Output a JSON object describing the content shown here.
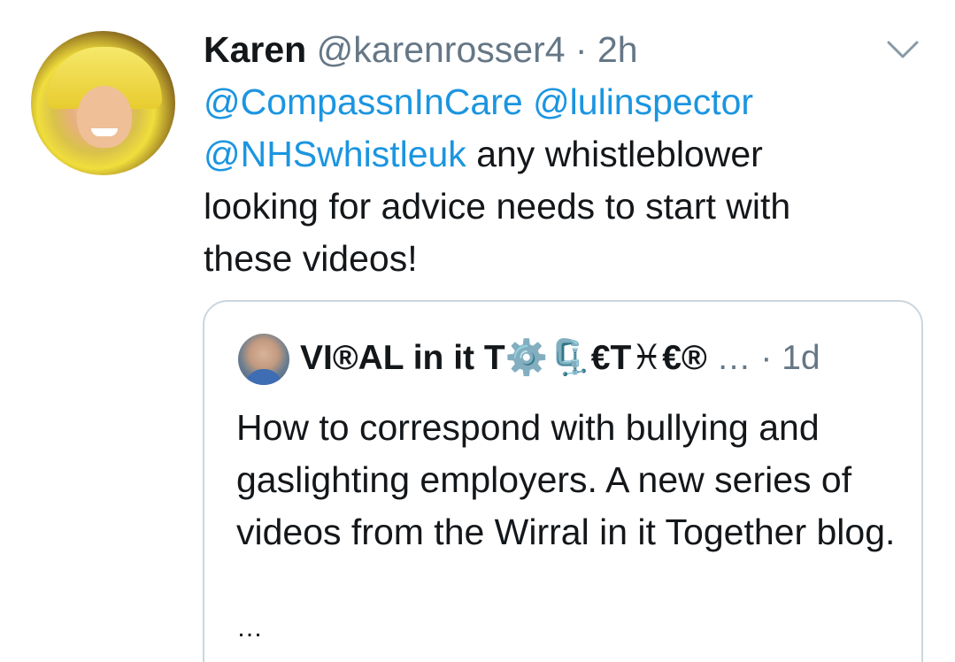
{
  "tweet": {
    "author_name": "Karen",
    "author_handle": "@karenrosser4",
    "separator": " · ",
    "time": "2h",
    "mention_1": "@CompassnInCare",
    "mention_2": "@lulinspector",
    "mention_3": "@NHSwhistleuk",
    "text_1": " any whistleblower",
    "text_2": "looking for advice needs to start with",
    "text_3": "these videos!"
  },
  "quoted_tweet": {
    "author_name": "VI®AL in it T⚙️🗜️€T♓€®",
    "truncation": " …",
    "separator": " · ",
    "time": "1d",
    "text": "How to correspond with bullying and gaslighting employers. A new series of videos from the Wirral in it Together blog.",
    "more": "…"
  },
  "colors": {
    "link": "#1b95e0",
    "secondary_text": "#657786",
    "border": "#ccd6dd"
  },
  "icons": {
    "menu": "chevron-down-icon"
  }
}
